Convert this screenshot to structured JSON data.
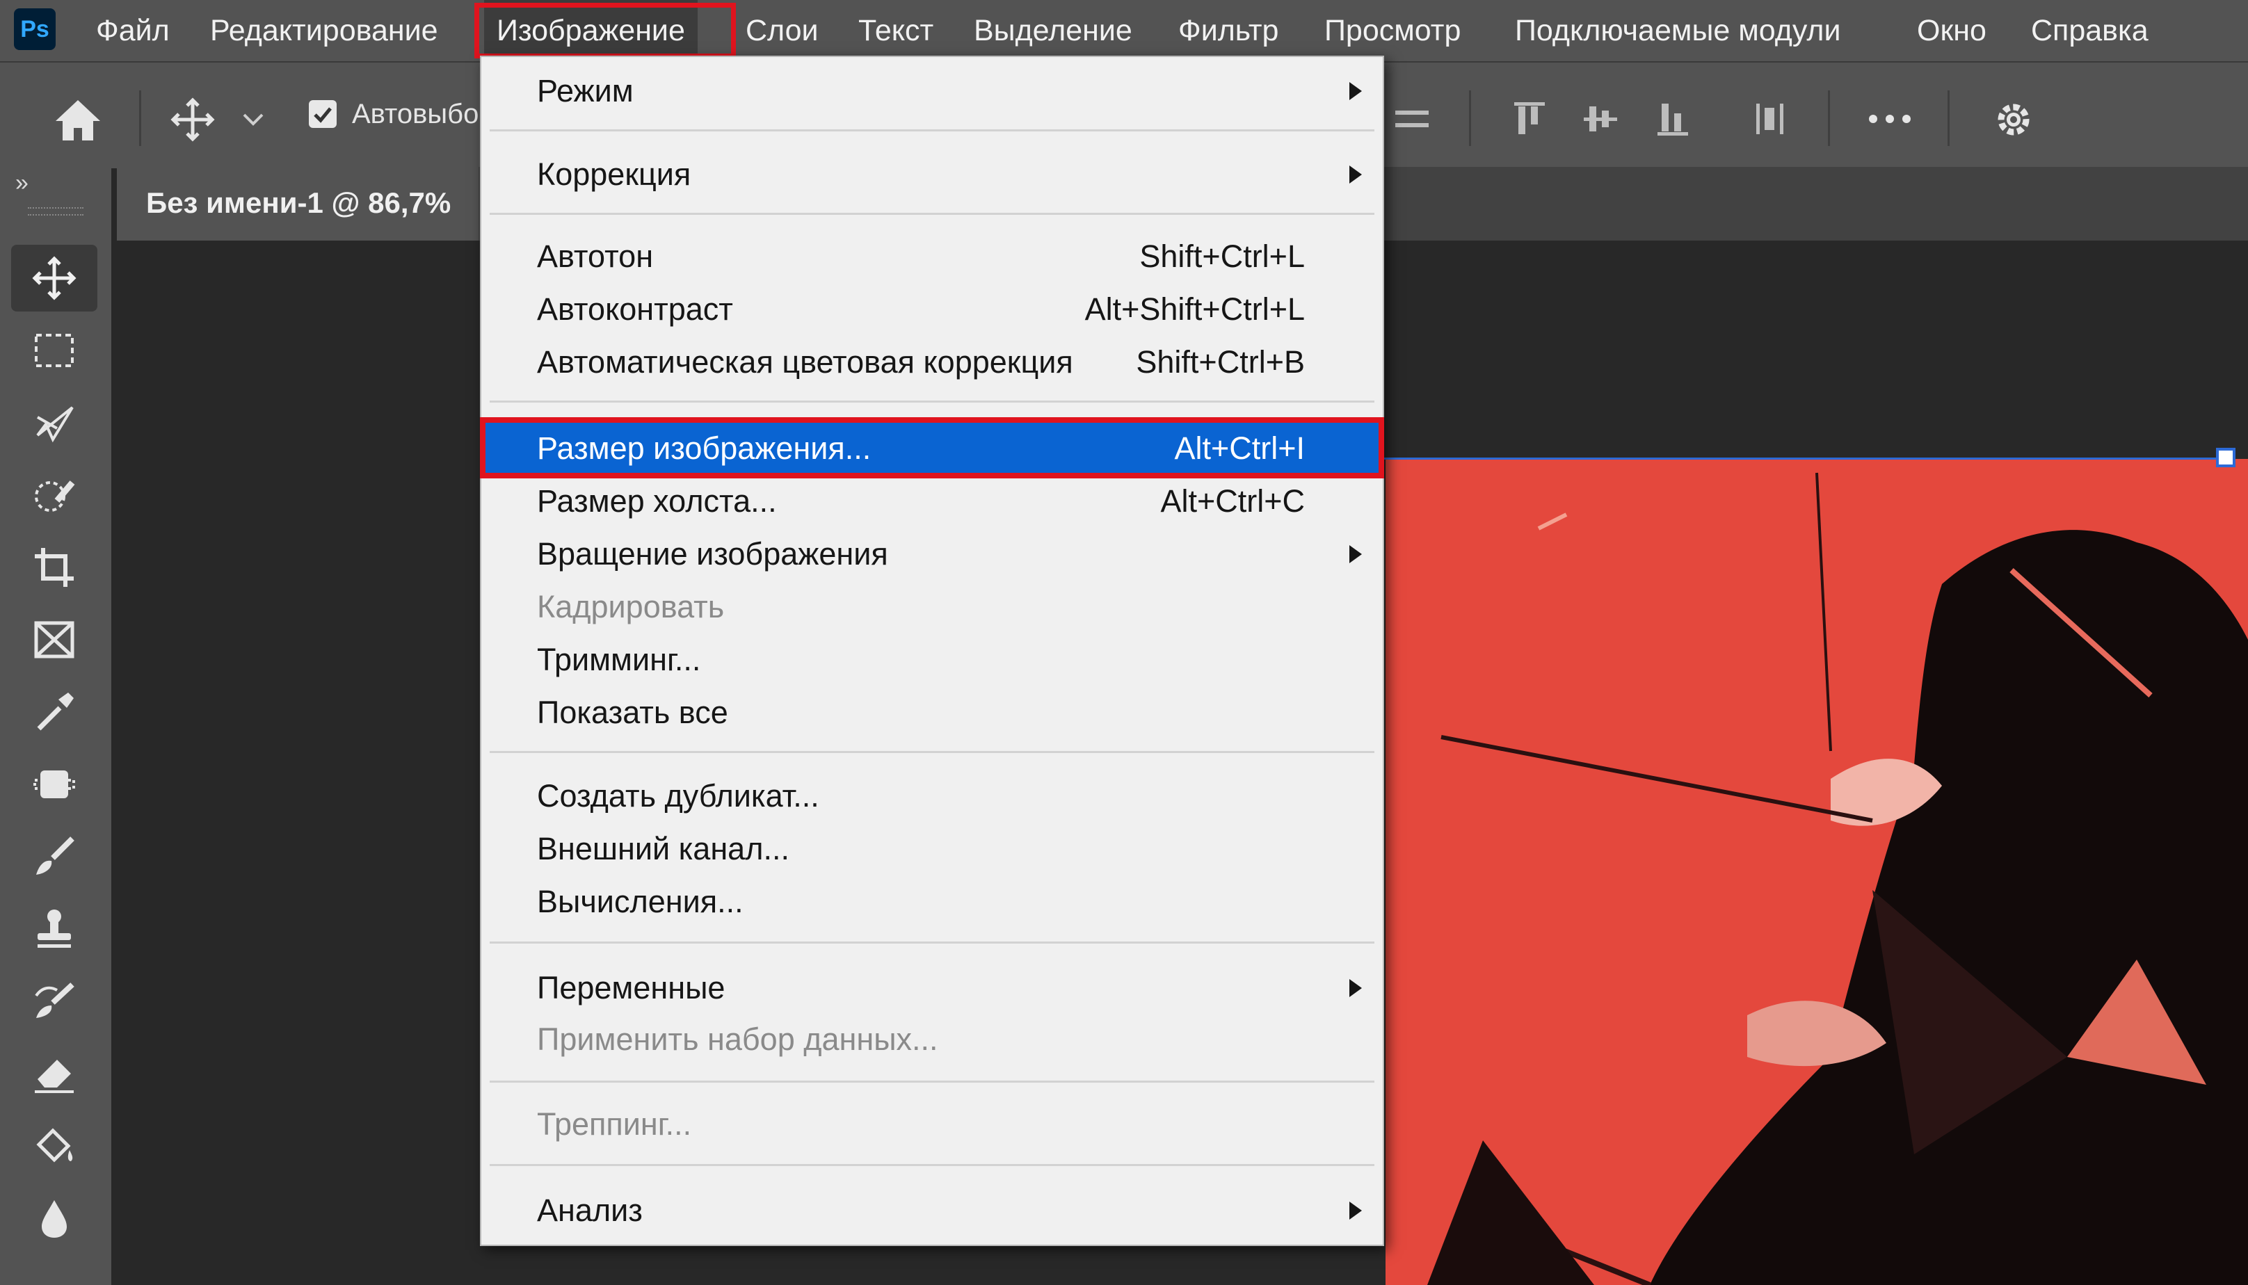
{
  "app": {
    "logo_text": "Ps",
    "accent": "#31a8ff"
  },
  "menubar": {
    "items": [
      {
        "label": "Файл"
      },
      {
        "label": "Редактирование"
      },
      {
        "label": "Изображение",
        "active": true
      },
      {
        "label": "Слои"
      },
      {
        "label": "Текст"
      },
      {
        "label": "Выделение"
      },
      {
        "label": "Фильтр"
      },
      {
        "label": "Просмотр"
      },
      {
        "label": "Подключаемые модули"
      },
      {
        "label": "Окно"
      },
      {
        "label": "Справка"
      }
    ],
    "highlight_color": "#e0141e"
  },
  "options": {
    "auto_select_label": "Автовыбо",
    "auto_select_checked": true
  },
  "document": {
    "tab_label": "Без имени-1 @ 86,7%"
  },
  "image_menu": {
    "items": [
      {
        "label": "Режим",
        "submenu": true
      },
      {
        "label": "Коррекция",
        "submenu": true
      },
      {
        "label": "Автотон",
        "shortcut": "Shift+Ctrl+L"
      },
      {
        "label": "Автоконтраст",
        "shortcut": "Alt+Shift+Ctrl+L"
      },
      {
        "label": "Автоматическая цветовая коррекция",
        "shortcut": "Shift+Ctrl+B"
      },
      {
        "label": "Размер изображения...",
        "shortcut": "Alt+Ctrl+I",
        "highlighted": true
      },
      {
        "label": "Размер холста...",
        "shortcut": "Alt+Ctrl+C"
      },
      {
        "label": "Вращение изображения",
        "submenu": true
      },
      {
        "label": "Кадрировать",
        "disabled": true
      },
      {
        "label": "Тримминг..."
      },
      {
        "label": "Показать все"
      },
      {
        "label": "Создать дубликат..."
      },
      {
        "label": "Внешний канал..."
      },
      {
        "label": "Вычисления..."
      },
      {
        "label": "Переменные",
        "submenu": true
      },
      {
        "label": "Применить набор данных...",
        "disabled": true
      },
      {
        "label": "Треппинг...",
        "disabled": true
      },
      {
        "label": "Анализ",
        "submenu": true
      }
    ],
    "highlight_color": "#0a64d2"
  },
  "toolbar": {
    "tools": [
      "move-tool-icon",
      "rectangular-marquee-icon",
      "lasso-icon",
      "quick-selection-icon",
      "crop-icon",
      "frame-icon",
      "eyedropper-icon",
      "spot-healing-icon",
      "brush-icon",
      "clone-stamp-icon",
      "history-brush-icon",
      "eraser-icon",
      "paint-bucket-icon",
      "blur-drop-icon"
    ]
  }
}
